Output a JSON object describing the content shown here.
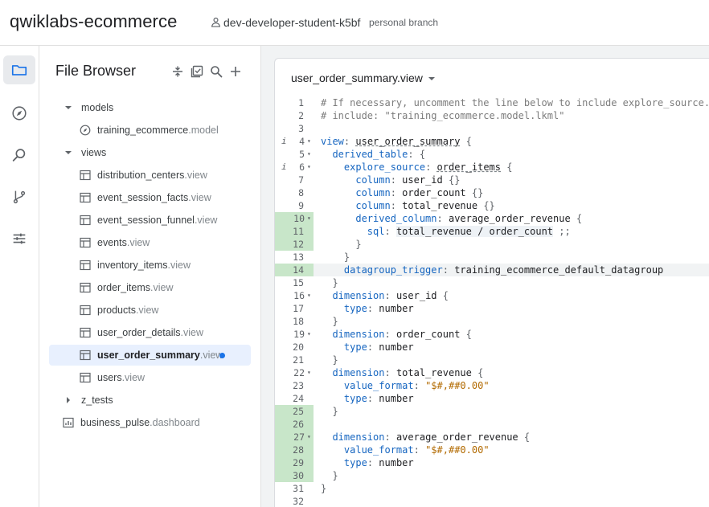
{
  "header": {
    "app_title": "qwiklabs-ecommerce",
    "branch_name": "dev-developer-student-k5bf",
    "branch_type": "personal branch"
  },
  "rail": {
    "items": [
      {
        "name": "file-browser",
        "icon": "folder-icon",
        "active": true
      },
      {
        "name": "object-browser",
        "icon": "compass-icon",
        "active": false
      },
      {
        "name": "search",
        "icon": "search-zoom-icon",
        "active": false
      },
      {
        "name": "git",
        "icon": "git-branch-icon",
        "active": false
      },
      {
        "name": "settings",
        "icon": "sliders-icon",
        "active": false
      }
    ]
  },
  "file_browser": {
    "title": "File Browser",
    "tools": [
      "collapse-icon",
      "validate-icon",
      "search-icon",
      "add-icon"
    ],
    "tree": [
      {
        "type": "folder",
        "label": "models",
        "ext": "",
        "expanded": true,
        "depth": 0
      },
      {
        "type": "model",
        "label": "training_ecommerce",
        "ext": ".model",
        "depth": 1
      },
      {
        "type": "folder",
        "label": "views",
        "ext": "",
        "expanded": true,
        "depth": 0
      },
      {
        "type": "view",
        "label": "distribution_centers",
        "ext": ".view",
        "depth": 1
      },
      {
        "type": "view",
        "label": "event_session_facts",
        "ext": ".view",
        "depth": 1
      },
      {
        "type": "view",
        "label": "event_session_funnel",
        "ext": ".view",
        "depth": 1
      },
      {
        "type": "view",
        "label": "events",
        "ext": ".view",
        "depth": 1
      },
      {
        "type": "view",
        "label": "inventory_items",
        "ext": ".view",
        "depth": 1
      },
      {
        "type": "view",
        "label": "order_items",
        "ext": ".view",
        "depth": 1
      },
      {
        "type": "view",
        "label": "products",
        "ext": ".view",
        "depth": 1
      },
      {
        "type": "view",
        "label": "user_order_details",
        "ext": ".view",
        "depth": 1
      },
      {
        "type": "view",
        "label": "user_order_summary",
        "ext": ".view",
        "depth": 1,
        "selected": true,
        "unsaved": true
      },
      {
        "type": "view",
        "label": "users",
        "ext": ".view",
        "depth": 1
      },
      {
        "type": "folder",
        "label": "z_tests",
        "ext": "",
        "expanded": false,
        "depth": 0
      },
      {
        "type": "dashboard",
        "label": "business_pulse",
        "ext": ".dashboard",
        "depth": -1
      }
    ]
  },
  "editor": {
    "file_name": "user_order_summary.view",
    "lines": [
      {
        "n": "1",
        "text": "# If necessary, uncomment the line below to include explore_source.",
        "kind": "comment"
      },
      {
        "n": "2",
        "text": "# include: \"training_ecommerce.model.lkml\"",
        "kind": "comment"
      },
      {
        "n": "3",
        "text": "",
        "kind": "plain"
      },
      {
        "n": "4",
        "text": "view: user_order_summary {",
        "kind": "view",
        "fold": true,
        "info": true
      },
      {
        "n": "5",
        "text": "  derived_table: {",
        "kind": "kv",
        "fold": true
      },
      {
        "n": "6",
        "text": "    explore_source: order_items {",
        "kind": "explore",
        "fold": true,
        "info": true
      },
      {
        "n": "7",
        "text": "      column: user_id {}",
        "kind": "kv"
      },
      {
        "n": "8",
        "text": "      column: order_count {}",
        "kind": "kv"
      },
      {
        "n": "9",
        "text": "      column: total_revenue {}",
        "kind": "kv"
      },
      {
        "n": "10",
        "text": "      derived_column: average_order_revenue {",
        "kind": "kv",
        "fold": true,
        "hl": true
      },
      {
        "n": "11",
        "text": "        sql: total_revenue / order_count ;;",
        "kind": "sql",
        "hl": true
      },
      {
        "n": "12",
        "text": "      }",
        "kind": "plain",
        "hl": true
      },
      {
        "n": "13",
        "text": "    }",
        "kind": "plain"
      },
      {
        "n": "14",
        "text": "    datagroup_trigger: training_ecommerce_default_datagroup",
        "kind": "kv",
        "hl": true,
        "active": true
      },
      {
        "n": "15",
        "text": "  }",
        "kind": "plain"
      },
      {
        "n": "16",
        "text": "  dimension: user_id {",
        "kind": "kv",
        "fold": true
      },
      {
        "n": "17",
        "text": "    type: number",
        "kind": "kv"
      },
      {
        "n": "18",
        "text": "  }",
        "kind": "plain"
      },
      {
        "n": "19",
        "text": "  dimension: order_count {",
        "kind": "kv",
        "fold": true
      },
      {
        "n": "20",
        "text": "    type: number",
        "kind": "kv"
      },
      {
        "n": "21",
        "text": "  }",
        "kind": "plain"
      },
      {
        "n": "22",
        "text": "  dimension: total_revenue {",
        "kind": "kv",
        "fold": true
      },
      {
        "n": "23",
        "text": "    value_format: \"$#,##0.00\"",
        "kind": "str"
      },
      {
        "n": "24",
        "text": "    type: number",
        "kind": "kv"
      },
      {
        "n": "25",
        "text": "  }",
        "kind": "plain",
        "hl": true
      },
      {
        "n": "26",
        "text": "",
        "kind": "plain",
        "hl": true
      },
      {
        "n": "27",
        "text": "  dimension: average_order_revenue {",
        "kind": "kv",
        "fold": true,
        "hl": true
      },
      {
        "n": "28",
        "text": "    value_format: \"$#,##0.00\"",
        "kind": "str",
        "hl": true
      },
      {
        "n": "29",
        "text": "    type: number",
        "kind": "kv",
        "hl": true
      },
      {
        "n": "30",
        "text": "  }",
        "kind": "plain",
        "hl": true
      },
      {
        "n": "31",
        "text": "}",
        "kind": "plain"
      },
      {
        "n": "32",
        "text": "",
        "kind": "plain"
      }
    ]
  },
  "colors": {
    "accent": "#1a73e8",
    "diff_highlight": "#c8e6c9",
    "selected_row": "#e8f0fe",
    "key": "#1565c0",
    "string": "#b26a00"
  }
}
